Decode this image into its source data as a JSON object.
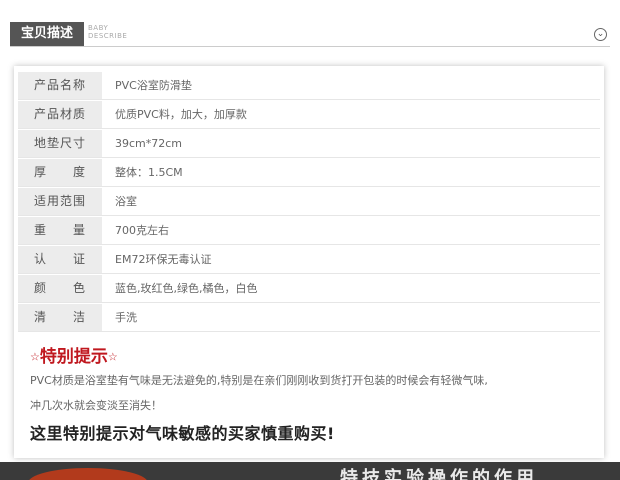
{
  "header": {
    "tab_label": "宝贝描述",
    "en_line1": "BABY",
    "en_line2": "DESCRIBE",
    "toggle_glyph": "⌄"
  },
  "specs": [
    {
      "label": "产品名称",
      "value": "PVC浴室防滑垫"
    },
    {
      "label": "产品材质",
      "value": "优质PVC料，加大，加厚款"
    },
    {
      "label": "地垫尺寸",
      "value": "39cm*72cm"
    },
    {
      "label": "厚　　度",
      "value": "整体：1.5CM"
    },
    {
      "label": "适用范围",
      "value": "浴室"
    },
    {
      "label": "重　　量",
      "value": "700克左右"
    },
    {
      "label": "认　　证",
      "value": "EM72环保无毒认证"
    },
    {
      "label": "颜　　色",
      "value": "蓝色,玫红色,绿色,橘色，白色"
    },
    {
      "label": "清　　洁",
      "value": "手洗"
    }
  ],
  "notice": {
    "star": "☆",
    "title": "特别提示",
    "body_line1": "PVC材质是浴室垫有气味是无法避免的,特别是在亲们刚刚收到货打开包装的时候会有轻微气味,",
    "body_line2": "冲几次水就会变淡至消失！",
    "warning": "这里特别提示对气味敏感的买家慎重购买!"
  },
  "banner": {
    "text": "特技实验操作的作用"
  },
  "colors": {
    "label_bg": "#ececec",
    "accent_red": "#c0181f",
    "header_tab": "#555555"
  }
}
